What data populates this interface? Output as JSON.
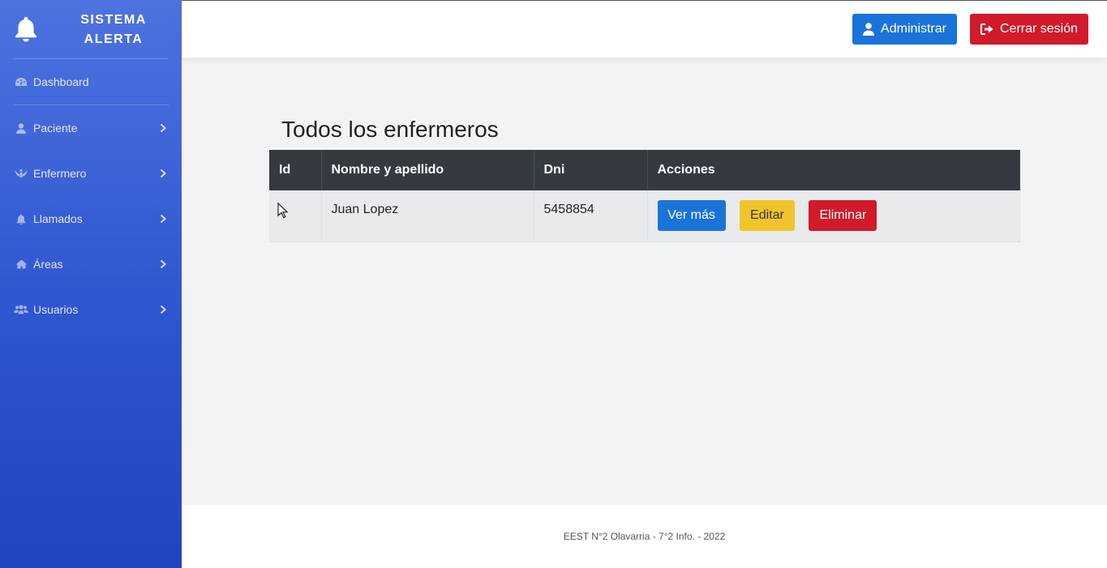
{
  "brand": {
    "line1": "SISTEMA",
    "line2": "ALERTA",
    "icon": "bell-icon"
  },
  "sidebar": {
    "items": [
      {
        "label": "Dashboard",
        "icon": "dashboard-icon"
      },
      {
        "label": "Paciente",
        "icon": "user-icon"
      },
      {
        "label": "Enfermero",
        "icon": "nurse-icon"
      },
      {
        "label": "Llamados",
        "icon": "bell-icon"
      },
      {
        "label": "Áreas",
        "icon": "home-icon"
      },
      {
        "label": "Usuarios",
        "icon": "users-icon"
      }
    ]
  },
  "topbar": {
    "admin_label": "Administrar",
    "logout_label": "Cerrar sesión"
  },
  "main": {
    "title": "Todos los enfermeros",
    "table": {
      "headers": [
        "Id",
        "Nombre y apellido",
        "Dni",
        "Acciones"
      ],
      "rows": [
        {
          "id": "",
          "name": "Juan Lopez",
          "dni": "5458854"
        }
      ],
      "actions": {
        "view": "Ver más",
        "edit": "Editar",
        "delete": "Eliminar"
      }
    }
  },
  "footer": {
    "text": "EEST N°2 Olavarria - 7°2 Info. - 2022"
  },
  "colors": {
    "primary": "#1a73d9",
    "danger": "#d11a2a",
    "warning": "#f2c42b",
    "sidebar": "#4e73df",
    "table_head": "#343a40"
  }
}
